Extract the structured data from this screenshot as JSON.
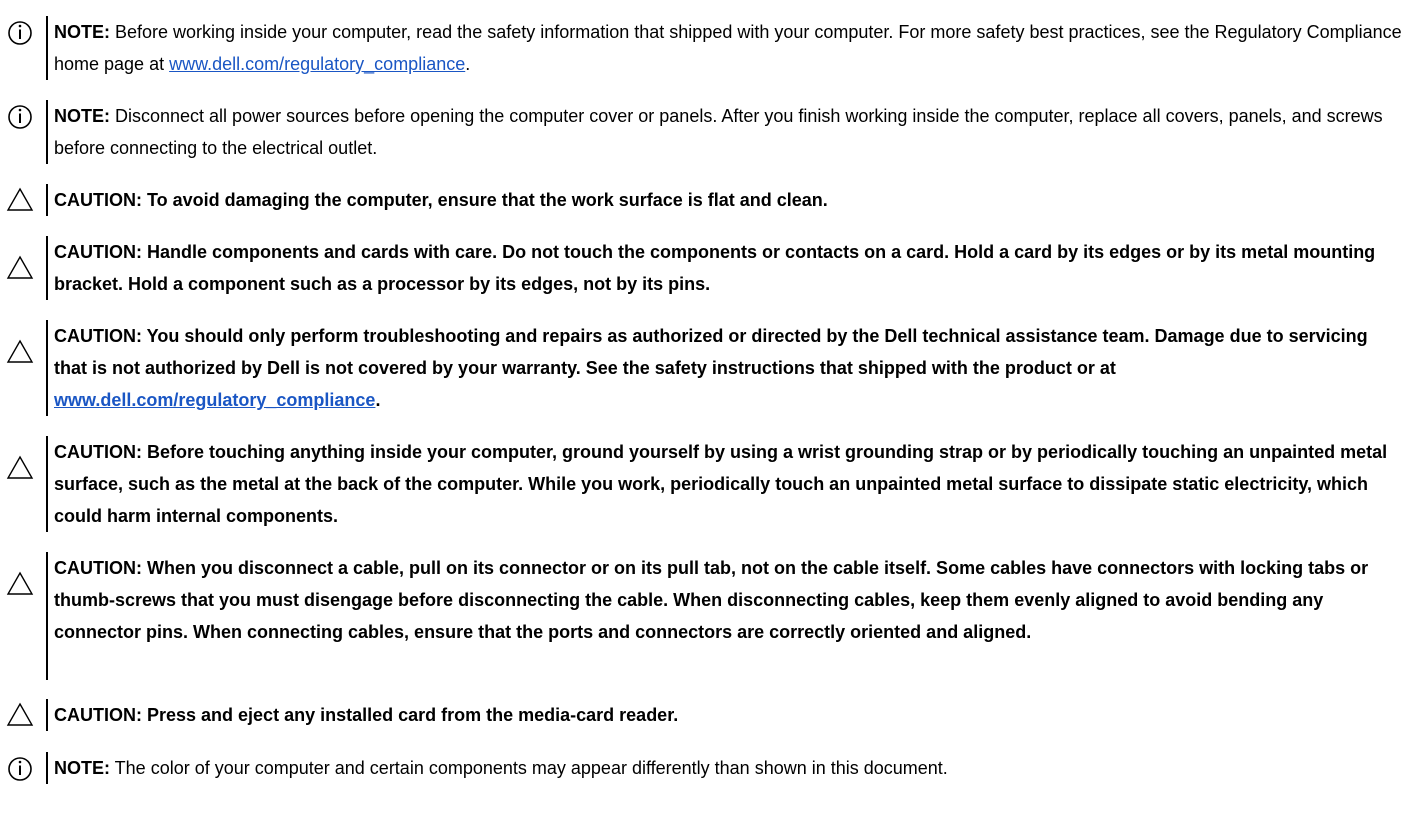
{
  "notices": [
    {
      "kind": "note",
      "icon": "info-circle-icon",
      "label": "NOTE:",
      "text_before": " Before working inside your computer, read the safety information that shipped with your computer. For more safety best practices, see the Regulatory Compliance home page at ",
      "link": "www.dell.com/regulatory_compliance",
      "text_after": "."
    },
    {
      "kind": "note",
      "icon": "info-circle-icon",
      "label": "NOTE:",
      "text": " Disconnect all power sources before opening the computer cover or panels. After you finish working inside the computer, replace all covers, panels, and screws before connecting to the electrical outlet."
    },
    {
      "kind": "caution",
      "icon": "warning-triangle-icon",
      "text": "CAUTION: To avoid damaging the computer, ensure that the work surface is flat and clean."
    },
    {
      "kind": "caution",
      "icon": "warning-triangle-icon",
      "text": "CAUTION: Handle components and cards with care. Do not touch the components or contacts on a card. Hold a card by its edges or by its metal mounting bracket. Hold a component such as a processor by its edges, not by its pins."
    },
    {
      "kind": "caution",
      "icon": "warning-triangle-icon",
      "text_before": "CAUTION: You should only perform troubleshooting and repairs as authorized or directed by the Dell technical assistance team. Damage due to servicing that is not authorized by Dell is not covered by your warranty. See the safety instructions that shipped with the product or at ",
      "link": "www.dell.com/regulatory_compliance",
      "text_after": "."
    },
    {
      "kind": "caution",
      "icon": "warning-triangle-icon",
      "text": "CAUTION: Before touching anything inside your computer, ground yourself by using a wrist grounding strap or by periodically touching an unpainted metal surface, such as the metal at the back of the computer. While you work, periodically touch an unpainted metal surface to dissipate static electricity, which could harm internal components."
    },
    {
      "kind": "caution",
      "icon": "warning-triangle-icon",
      "text": "CAUTION: When you disconnect a cable, pull on its connector or on its pull tab, not on the cable itself. Some cables have connectors with locking tabs or thumb-screws that you must disengage before disconnecting the cable. When disconnecting cables, keep them evenly aligned to avoid bending any connector pins. When connecting cables, ensure that the ports and connectors are correctly oriented and aligned."
    },
    {
      "kind": "caution",
      "icon": "warning-triangle-icon",
      "text": "CAUTION: Press and eject any installed card from the media-card reader."
    },
    {
      "kind": "note",
      "icon": "info-circle-icon",
      "label": "NOTE:",
      "text": " The color of your computer and certain components may appear differently than shown in this document."
    }
  ],
  "colors": {
    "link": "#1a56c4",
    "text": "#000000"
  }
}
